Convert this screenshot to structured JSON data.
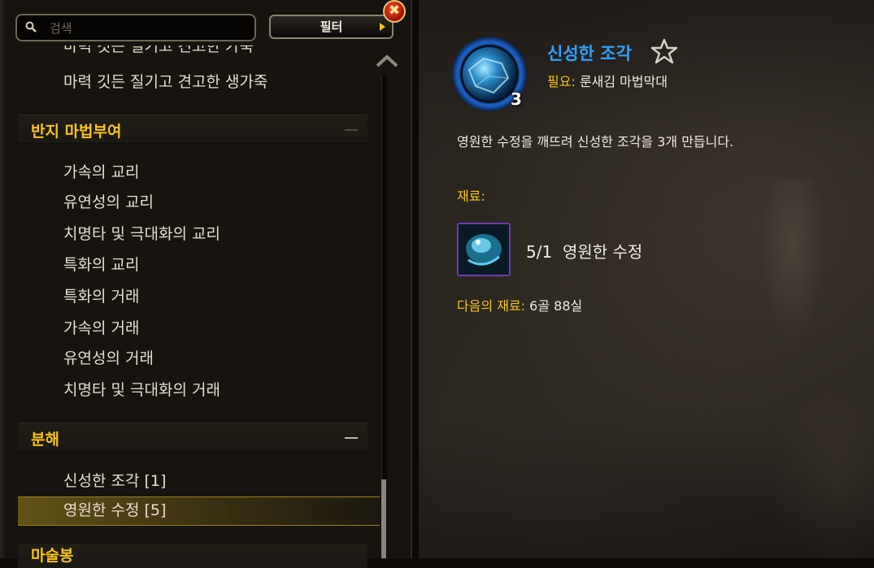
{
  "search": {
    "placeholder": "검색"
  },
  "filter": {
    "label": "필터"
  },
  "close": {
    "glyph": "✖"
  },
  "list": {
    "cut_item": "마력 깃든 질기고 견고한 가죽",
    "top_item": "마력 깃든 질기고 견고한 생가죽",
    "categories": [
      {
        "name": "반지 마법부여",
        "items": [
          "가속의 교리",
          "유연성의 교리",
          "치명타 및 극대화의 교리",
          "특화의 교리",
          "특화의 거래",
          "가속의 거래",
          "유연성의 거래",
          "치명타 및 극대화의 거래"
        ]
      },
      {
        "name": "분해",
        "items": [
          "신성한 조각 [1]",
          "영원한 수정 [5]"
        ]
      },
      {
        "name": "마술봉",
        "items": []
      }
    ],
    "selected_index": 1
  },
  "detail": {
    "item_name": "신성한 조각",
    "item_count": "3",
    "requires_label": "필요:",
    "requires_value": "룬새김 마법막대",
    "description": "영원한 수정을 깨뜨려 신성한 조각을 3개 만듭니다.",
    "materials_label": "재료:",
    "reagent": {
      "have": "5",
      "need": "1",
      "name": "영원한 수정"
    },
    "cost_label": "다음의 재료:",
    "cost_value": "6골 88실"
  },
  "colors": {
    "gold": "#f4c419",
    "item_rare": "#2ea1ff",
    "text": "#f0ebe0",
    "reagent_border": "#6b3cb0"
  },
  "icons": [
    "search-icon",
    "filter-arrow-icon",
    "close-icon",
    "collapse-icon",
    "scroll-up-icon",
    "favorite-star-icon",
    "item-icon",
    "reagent-icon"
  ]
}
